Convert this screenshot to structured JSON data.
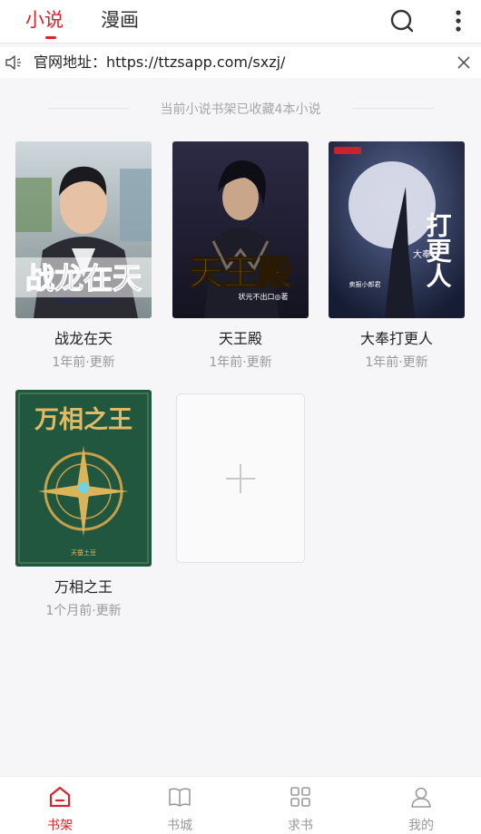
{
  "header": {
    "tabs": [
      {
        "label": "小说"
      },
      {
        "label": "漫画"
      }
    ]
  },
  "notice": {
    "text": "官网地址：https://ttzsapp.com/sxzj/"
  },
  "shelf": {
    "info": "当前小说书架已收藏4本小说",
    "books": [
      {
        "title": "战龙在天",
        "updated": "1年前·更新",
        "cover_text": "战龙在天",
        "cover_sub": "ZHANLONGZAITIAN"
      },
      {
        "title": "天王殿",
        "updated": "1年前·更新",
        "cover_text": "天王殿",
        "cover_sub": "状元不出口◎著"
      },
      {
        "title": "大奉打更人",
        "updated": "1年前·更新",
        "cover_text": "打更人",
        "cover_sub": "大奉",
        "cover_author": "卖报小郎君"
      },
      {
        "title": "万相之王",
        "updated": "1个月前·更新",
        "cover_text": "万相之王",
        "cover_sub": "天蚕土豆"
      }
    ]
  },
  "nav": {
    "items": [
      {
        "label": "书架",
        "icon": "home-icon"
      },
      {
        "label": "书城",
        "icon": "book-icon"
      },
      {
        "label": "求书",
        "icon": "grid-icon"
      },
      {
        "label": "我的",
        "icon": "user-icon"
      }
    ]
  },
  "colors": {
    "accent": "#d8232a",
    "muted": "#999999",
    "background": "#f6f6f8"
  }
}
